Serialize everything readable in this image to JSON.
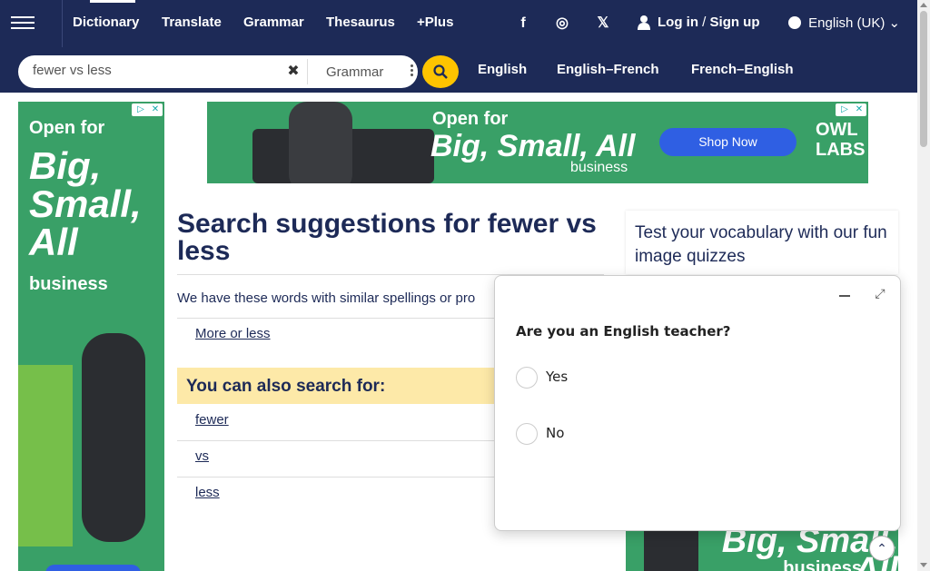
{
  "nav": {
    "items": [
      "Dictionary",
      "Translate",
      "Grammar",
      "Thesaurus",
      "+Plus"
    ],
    "social": {
      "facebook": "f",
      "instagram": "◎",
      "x": "𝕏"
    },
    "login": "Log in",
    "slash": "/",
    "signup": "Sign up",
    "language": "English (UK)",
    "chevron": "⌄"
  },
  "search": {
    "query": "fewer vs less",
    "clear_glyph": "✖",
    "scope": "Grammar",
    "quick_links": [
      "English",
      "English–French",
      "French–English"
    ]
  },
  "ads": {
    "left": {
      "line1": "Open for",
      "line2": "Big, Small, All",
      "line3": "business"
    },
    "top": {
      "line1": "Open for",
      "line2": "Big, Small, All",
      "line3": "business",
      "cta": "Shop Now",
      "brand": "OWL LABS"
    },
    "bottom": {
      "line1": "Big, Small, All",
      "line2": "business"
    }
  },
  "main": {
    "title_prefix": "Search suggestions for ",
    "title_term": "fewer vs less",
    "similar_text": "We have these words with similar spellings or pro",
    "suggestion": "More or less",
    "also_heading": "You can also search for:",
    "also_links": [
      "fewer",
      "vs",
      "less"
    ]
  },
  "quiz": {
    "heading": "Test your vocabulary with our fun image quizzes"
  },
  "survey": {
    "question": "Are you an English teacher?",
    "options": [
      "Yes",
      "No"
    ],
    "expand_glyph": "⤢"
  },
  "totop_glyph": "⌃",
  "colors": {
    "nav_bg": "#1d2a57",
    "search_btn": "#fec400",
    "ad_green": "#39a067",
    "also_bg": "#fde9a8"
  }
}
